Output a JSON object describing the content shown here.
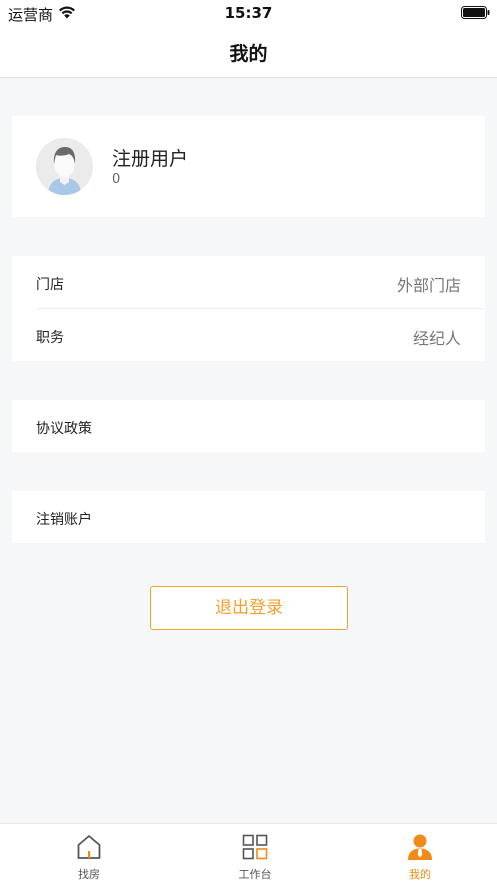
{
  "status_bar": {
    "carrier": "运营商",
    "time": "15:37"
  },
  "nav": {
    "title": "我的"
  },
  "profile": {
    "name": "注册用户",
    "id": "0"
  },
  "info": {
    "store_label": "门店",
    "store_value": "外部门店",
    "position_label": "职务",
    "position_value": "经纪人"
  },
  "menu": {
    "agreement_label": "协议政策",
    "cancel_account_label": "注销账户"
  },
  "logout": {
    "label": "退出登录"
  },
  "tabs": [
    {
      "label": "找房",
      "icon": "house-icon"
    },
    {
      "label": "工作台",
      "icon": "grid-icon"
    },
    {
      "label": "我的",
      "icon": "person-icon",
      "active": true
    }
  ],
  "colors": {
    "accent": "#f0a130",
    "active_tab": "#f08a18",
    "background": "#f6f7f9"
  }
}
